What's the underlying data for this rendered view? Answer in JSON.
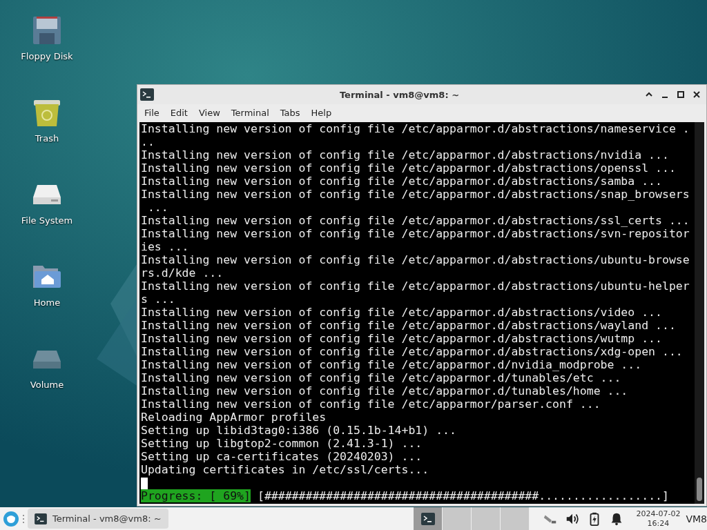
{
  "desktop_icons": [
    {
      "label": "Floppy Disk",
      "kind": "floppy"
    },
    {
      "label": "Trash",
      "kind": "trash"
    },
    {
      "label": "File System",
      "kind": "drive"
    },
    {
      "label": "Home",
      "kind": "home"
    },
    {
      "label": "Volume",
      "kind": "volume"
    }
  ],
  "window": {
    "title": "Terminal - vm8@vm8: ~",
    "menu": [
      "File",
      "Edit",
      "View",
      "Terminal",
      "Tabs",
      "Help"
    ],
    "lines": [
      "Installing new version of config file /etc/apparmor.d/abstractions/nameservice .",
      "..",
      "Installing new version of config file /etc/apparmor.d/abstractions/nvidia ...",
      "Installing new version of config file /etc/apparmor.d/abstractions/openssl ...",
      "Installing new version of config file /etc/apparmor.d/abstractions/samba ...",
      "Installing new version of config file /etc/apparmor.d/abstractions/snap_browsers",
      " ...",
      "Installing new version of config file /etc/apparmor.d/abstractions/ssl_certs ...",
      "Installing new version of config file /etc/apparmor.d/abstractions/svn-repositor",
      "ies ...",
      "Installing new version of config file /etc/apparmor.d/abstractions/ubuntu-browse",
      "rs.d/kde ...",
      "Installing new version of config file /etc/apparmor.d/abstractions/ubuntu-helper",
      "s ...",
      "Installing new version of config file /etc/apparmor.d/abstractions/video ...",
      "Installing new version of config file /etc/apparmor.d/abstractions/wayland ...",
      "Installing new version of config file /etc/apparmor.d/abstractions/wutmp ...",
      "Installing new version of config file /etc/apparmor.d/abstractions/xdg-open ...",
      "Installing new version of config file /etc/apparmor.d/nvidia_modprobe ...",
      "Installing new version of config file /etc/apparmor.d/tunables/etc ...",
      "Installing new version of config file /etc/apparmor.d/tunables/home ...",
      "Installing new version of config file /etc/apparmor/parser.conf ...",
      "Reloading AppArmor profiles",
      "Setting up libid3tag0:i386 (0.15.1b-14+b1) ...",
      "Setting up libgtop2-common (2.41.3-1) ...",
      "Setting up ca-certificates (20240203) ...",
      "Updating certificates in /etc/ssl/certs..."
    ],
    "progress_label": "Progress: [ 69%]",
    "progress_bar": "[########################################..................]"
  },
  "taskbar": {
    "task": "Terminal - vm8@vm8: ~",
    "workspaces": [
      {
        "selected": true
      },
      {
        "selected": false
      },
      {
        "selected": false
      },
      {
        "selected": false
      }
    ],
    "date": "2024-07-02",
    "time": "16:24",
    "user": "VM8"
  }
}
